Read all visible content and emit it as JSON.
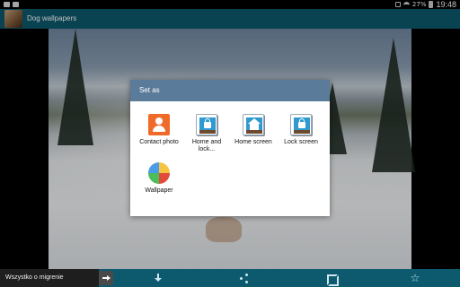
{
  "status_bar": {
    "battery_percent": "27%",
    "time": "19:48",
    "icons": [
      "mute-icon",
      "wifi-icon",
      "battery-icon"
    ]
  },
  "action_bar": {
    "title": "Dog wallpapers",
    "background": "#0d5a6e"
  },
  "dialog": {
    "title": "Set as",
    "header_color": "#5b7b9b",
    "options": [
      {
        "label": "Contact photo",
        "icon": "contact-icon"
      },
      {
        "label": "Home and lock...",
        "icon": "lock-photo-icon"
      },
      {
        "label": "Home screen",
        "icon": "home-icon"
      },
      {
        "label": "Lock screen",
        "icon": "lock-screen-icon"
      },
      {
        "label": "Wallpaper",
        "icon": "pinwheel-icon"
      }
    ]
  },
  "bottom_bar": {
    "language_label": "Wszystko o migrenie",
    "icons": [
      "arrow-right-icon",
      "download-icon",
      "share-icon",
      "crop-icon",
      "star-icon"
    ],
    "star_glyph": "☆"
  }
}
